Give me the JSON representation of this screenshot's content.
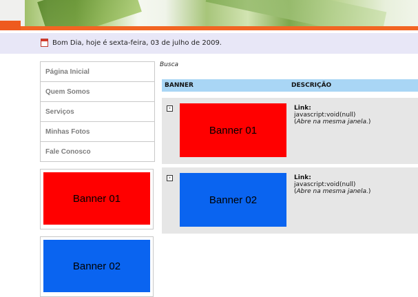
{
  "greeting": {
    "text": "Bom Dia, hoje é sexta-feira, 03 de julho de 2009."
  },
  "menu": {
    "items": [
      {
        "label": "Página Inicial"
      },
      {
        "label": "Quem Somos"
      },
      {
        "label": "Serviços"
      },
      {
        "label": "Minhas Fotos"
      },
      {
        "label": "Fale Conosco"
      }
    ]
  },
  "sidebar_banners": [
    {
      "label": "Banner 01",
      "color": "#ff0000"
    },
    {
      "label": "Banner 02",
      "color": "#0a64f0"
    }
  ],
  "search": {
    "label": "Busca"
  },
  "table": {
    "headers": {
      "banner": "BANNER",
      "description": "DESCRIÇÃO"
    },
    "rows": [
      {
        "banner": "Banner 01",
        "color": "#ff0000",
        "link_label": "Link:",
        "link": "javascript:void(null)",
        "target_open": "(",
        "target": "Abre na mesma janela.",
        "target_close": ")"
      },
      {
        "banner": "Banner 02",
        "color": "#0a64f0",
        "link_label": "Link:",
        "link": "javascript:void(null)",
        "target_open": "(",
        "target": "Abre na mesma janela.",
        "target_close": ")"
      }
    ]
  },
  "colors": {
    "accent": "#f26522",
    "header_row": "#a9d6f5",
    "greeting_bg": "#e8e7f7"
  }
}
